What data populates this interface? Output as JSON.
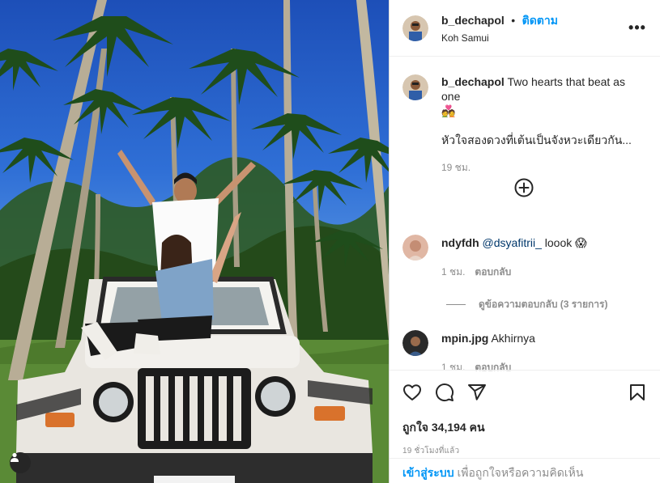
{
  "header": {
    "username": "b_dechapol",
    "separator": "•",
    "follow_label": "ติดตาม",
    "location": "Koh Samui",
    "more_label": "•••"
  },
  "caption": {
    "username": "b_dechapol",
    "text_en": "Two hearts that beat as one",
    "emoji": "💑",
    "text_th": "หัวใจสองดวงที่เต้นเป็นจังหวะเดียวกัน...",
    "age": "19 ชม."
  },
  "comments": [
    {
      "username": "ndyfdh",
      "mention": "@dsyafitrii_",
      "text": "loook",
      "emoji": "😱",
      "age": "1 ชม.",
      "reply_label": "ตอบกลับ",
      "view_replies": "ดูข้อความตอบกลับ (3 รายการ)"
    },
    {
      "username": "mpin.jpg",
      "text": "Akhirnya",
      "age": "1 ชม.",
      "reply_label": "ตอบกลับ"
    }
  ],
  "actions": {
    "likes": "ถูกใจ 34,194 คน",
    "time": "19 ชั่วโมงที่แล้ว"
  },
  "login_bar": {
    "login_link": "เข้าสู่ระบบ",
    "rest": " เพื่อถูกใจหรือความคิดเห็น"
  },
  "icons": {
    "like": "heart-icon",
    "comment": "comment-icon",
    "share": "share-icon",
    "save": "bookmark-icon",
    "add": "plus-circle-icon",
    "tag": "user-tag-icon"
  },
  "colors": {
    "accent": "#0095f6",
    "muted": "#8e8e8e",
    "text": "#262626"
  }
}
